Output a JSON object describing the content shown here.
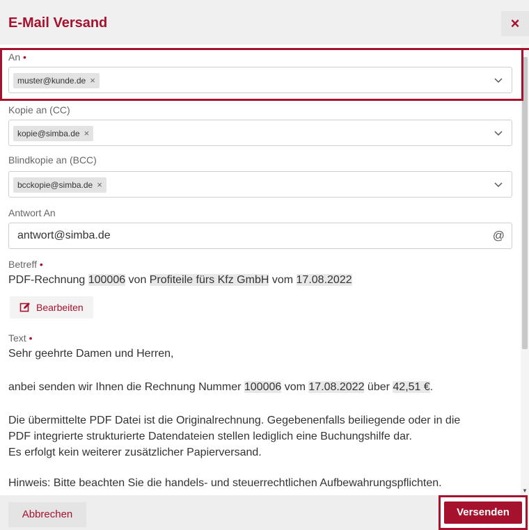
{
  "dialog": {
    "title": "E-Mail Versand",
    "close_glyph": "×"
  },
  "fields": {
    "to": {
      "label": "An",
      "required_mark": "•",
      "chip": "muster@kunde.de",
      "chip_remove": "×"
    },
    "cc": {
      "label": "Kopie an (CC)",
      "chip": "kopie@simba.de",
      "chip_remove": "×"
    },
    "bcc": {
      "label": "Blindkopie an (BCC)",
      "chip": "bcckopie@simba.de",
      "chip_remove": "×"
    },
    "reply_to": {
      "label": "Antwort An",
      "value": "antwort@simba.de",
      "icon_glyph": "@"
    }
  },
  "subject": {
    "label": "Betreff",
    "required_mark": "•",
    "parts": [
      "PDF-Rechnung ",
      "100006",
      " von ",
      "Profiteile fürs Kfz GmbH",
      " vom ",
      "17.08.2022"
    ]
  },
  "edit_button": {
    "label": "Bearbeiten"
  },
  "text": {
    "label": "Text",
    "required_mark": "•",
    "greeting": "Sehr geehrte Damen und Herren,",
    "line1_parts": [
      "anbei senden wir Ihnen die Rechnung Nummer ",
      "100006",
      " vom ",
      "17.08.2022",
      " über ",
      "42,51 €",
      "."
    ],
    "para2_l1": "Die übermittelte PDF Datei ist die Originalrechnung. Gegebenenfalls beiliegende oder in die",
    "para2_l2": "PDF integrierte strukturierte Datendateien stellen lediglich eine Buchungshilfe dar.",
    "para2_l3": "Es erfolgt kein weiterer zusätzlicher Papierversand.",
    "para3_l1": "Hinweis: Bitte beachten Sie die handels- und steuerrechtlichen Aufbewahrungspflichten."
  },
  "footer": {
    "cancel_label": "Abbrechen",
    "send_label": "Versenden"
  },
  "colors": {
    "accent": "#a6112e",
    "chip_bg": "#e3e3e3",
    "highlight_bg": "#e8e8e8"
  },
  "icons": {
    "close": "close-icon",
    "chevron": "chevron-down-icon",
    "at": "at-sign-icon",
    "edit": "edit-icon"
  }
}
